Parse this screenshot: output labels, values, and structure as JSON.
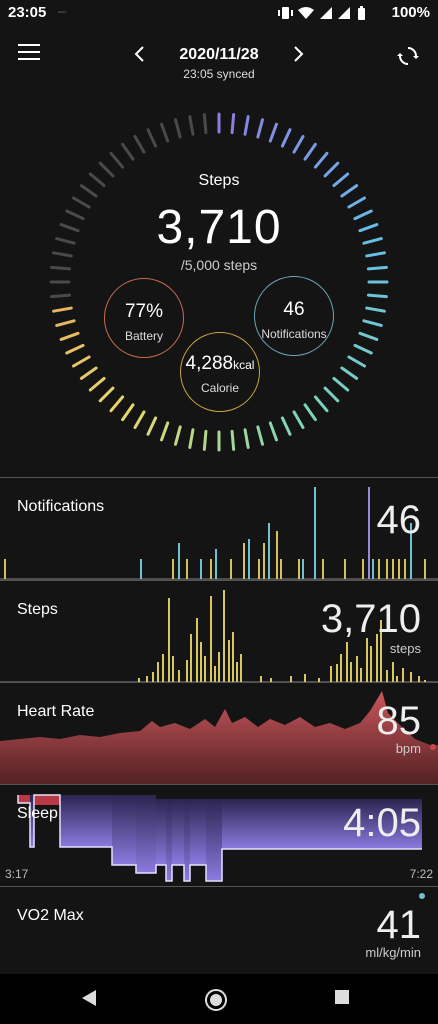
{
  "status_bar": {
    "time": "23:05",
    "battery": "100%",
    "icons": [
      "vibrate-icon",
      "wifi-icon",
      "signal-icon",
      "signal-icon",
      "battery-icon"
    ]
  },
  "header": {
    "date": "2020/11/28",
    "synced": "23:05 synced"
  },
  "summary": {
    "steps_title": "Steps",
    "steps_value": "3,710",
    "steps_goal": "/5,000 steps",
    "steps_progress": 0.742,
    "battery_value": "77%",
    "battery_label": "Battery",
    "notifications_value": "46",
    "notifications_label": "Notifications",
    "calorie_value": "4,288",
    "calorie_unit": "kcal",
    "calorie_label": "Calorie",
    "colors": {
      "battery": "#c96a4e",
      "notifications": "#6da3b8",
      "calorie": "#c9a441"
    }
  },
  "panels": {
    "notifications": {
      "title": "Notifications",
      "value": "46",
      "colors": [
        "#d6c25b",
        "#6fc0d0",
        "#9b8ad6"
      ]
    },
    "steps": {
      "title": "Steps",
      "value": "3,710",
      "unit": "steps",
      "color": "#d9c860"
    },
    "heart_rate": {
      "title": "Heart Rate",
      "value": "85",
      "unit": "bpm",
      "color": "#c24a4f"
    },
    "sleep": {
      "title": "Sleep",
      "value": "4:05",
      "start": "3:17",
      "end": "7:22",
      "color": "#7f6fd0"
    },
    "vo2max": {
      "title": "VO2 Max",
      "value": "41",
      "unit": "ml/kg/min",
      "color": "#6fc0d0"
    }
  }
}
